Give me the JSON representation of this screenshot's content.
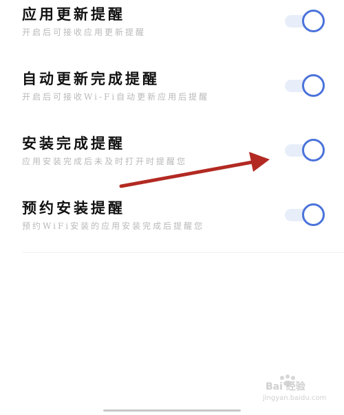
{
  "settings": [
    {
      "title": "应用更新提醒",
      "desc": "开启后可接收应用更新提醒",
      "enabled": true
    },
    {
      "title": "自动更新完成提醒",
      "desc": "开启后可接收Wi-Fi自动更新应用后提醒",
      "enabled": true
    },
    {
      "title": "安装完成提醒",
      "desc": "应用安装完成后未及时打开时提醒您",
      "enabled": true
    },
    {
      "title": "预约安装提醒",
      "desc": "预约WiFi安装的应用安装完成后提醒您",
      "enabled": true
    }
  ],
  "colors": {
    "accent": "#4a72da",
    "toggle_track": "#e7eef9",
    "annotation_arrow": "#b22a22"
  },
  "watermark": {
    "brand": "Bai 经验",
    "url": "jingyan.baidu.com"
  }
}
